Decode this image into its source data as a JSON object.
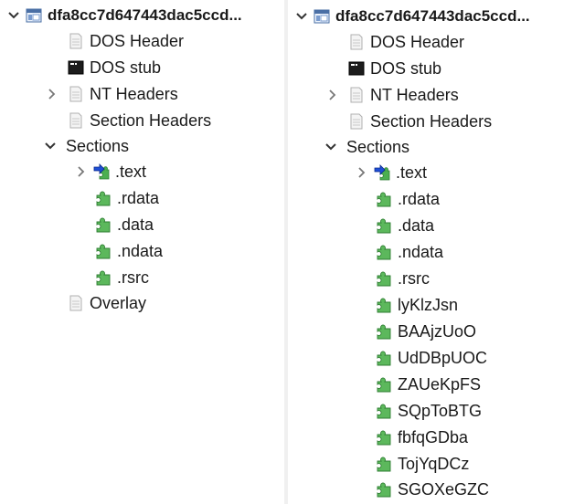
{
  "left_tree": {
    "root_label": "dfa8cc7d647443dac5ccd...",
    "dos_header": "DOS Header",
    "dos_stub": "DOS stub",
    "nt_headers": "NT Headers",
    "section_headers": "Section Headers",
    "sections_label": "Sections",
    "sections": [
      ".text",
      ".rdata",
      ".data",
      ".ndata",
      ".rsrc"
    ],
    "overlay": "Overlay"
  },
  "right_tree": {
    "root_label": "dfa8cc7d647443dac5ccd...",
    "dos_header": "DOS Header",
    "dos_stub": "DOS stub",
    "nt_headers": "NT Headers",
    "section_headers": "Section Headers",
    "sections_label": "Sections",
    "sections": [
      ".text",
      ".rdata",
      ".data",
      ".ndata",
      ".rsrc",
      "lyKlzJsn",
      "BAAjzUoO",
      "UdDBpUOC",
      "ZAUeKpFS",
      "SQpToBTG",
      "fbfqGDba",
      "TojYqDCz",
      "SGOXeGZC"
    ]
  },
  "icons": {
    "root": "executable-file-icon",
    "header": "document-page-icon",
    "stub": "console-window-icon",
    "section": "green-puzzle-piece-icon",
    "entry": "blue-arrow-entry-icon"
  }
}
